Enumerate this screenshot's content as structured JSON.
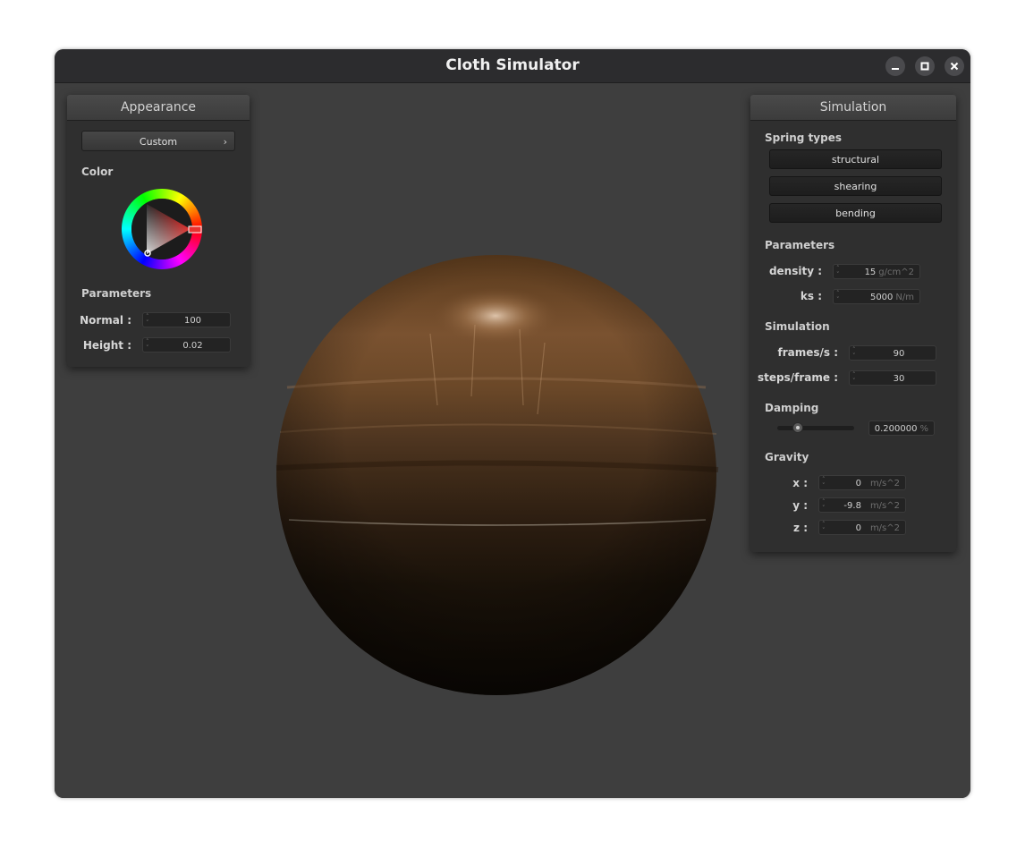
{
  "window": {
    "title": "Cloth Simulator",
    "controls": [
      "minimize-icon",
      "maximize-icon",
      "close-icon"
    ]
  },
  "appearance": {
    "header": "Appearance",
    "shader_dropdown": {
      "value": "Custom",
      "icon": "chevron-right-icon"
    },
    "color_label": "Color",
    "color_wheel": {
      "selected_color": "#e8322f"
    },
    "parameters_label": "Parameters",
    "normal": {
      "label": "Normal :",
      "value": "100"
    },
    "height": {
      "label": "Height :",
      "value": "0.02"
    }
  },
  "simulation": {
    "header": "Simulation",
    "spring_types_label": "Spring types",
    "spring_buttons": [
      "structural",
      "shearing",
      "bending"
    ],
    "parameters_label": "Parameters",
    "density": {
      "label": "density :",
      "value": "15",
      "unit": "g/cm^2"
    },
    "ks": {
      "label": "ks :",
      "value": "5000",
      "unit": "N/m"
    },
    "simulation_label": "Simulation",
    "fps": {
      "label": "frames/s :",
      "value": "90"
    },
    "steps": {
      "label": "steps/frame :",
      "value": "30"
    },
    "damping_label": "Damping",
    "damping": {
      "value": "0.200000",
      "unit": "%",
      "slider_fraction": 0.2
    },
    "gravity_label": "Gravity",
    "gx": {
      "label": "x :",
      "value": "0",
      "unit": "m/s^2"
    },
    "gy": {
      "label": "y :",
      "value": "-9.8",
      "unit": "m/s^2"
    },
    "gz": {
      "label": "z :",
      "value": "0",
      "unit": "m/s^2"
    }
  },
  "colors": {
    "window_bg": "#3e3e3e",
    "titlebar": "#2c2c2e",
    "panel_bg": "#2f2f2f",
    "sphere_highlight": "#8a6234",
    "sphere_dark": "#120c06"
  }
}
